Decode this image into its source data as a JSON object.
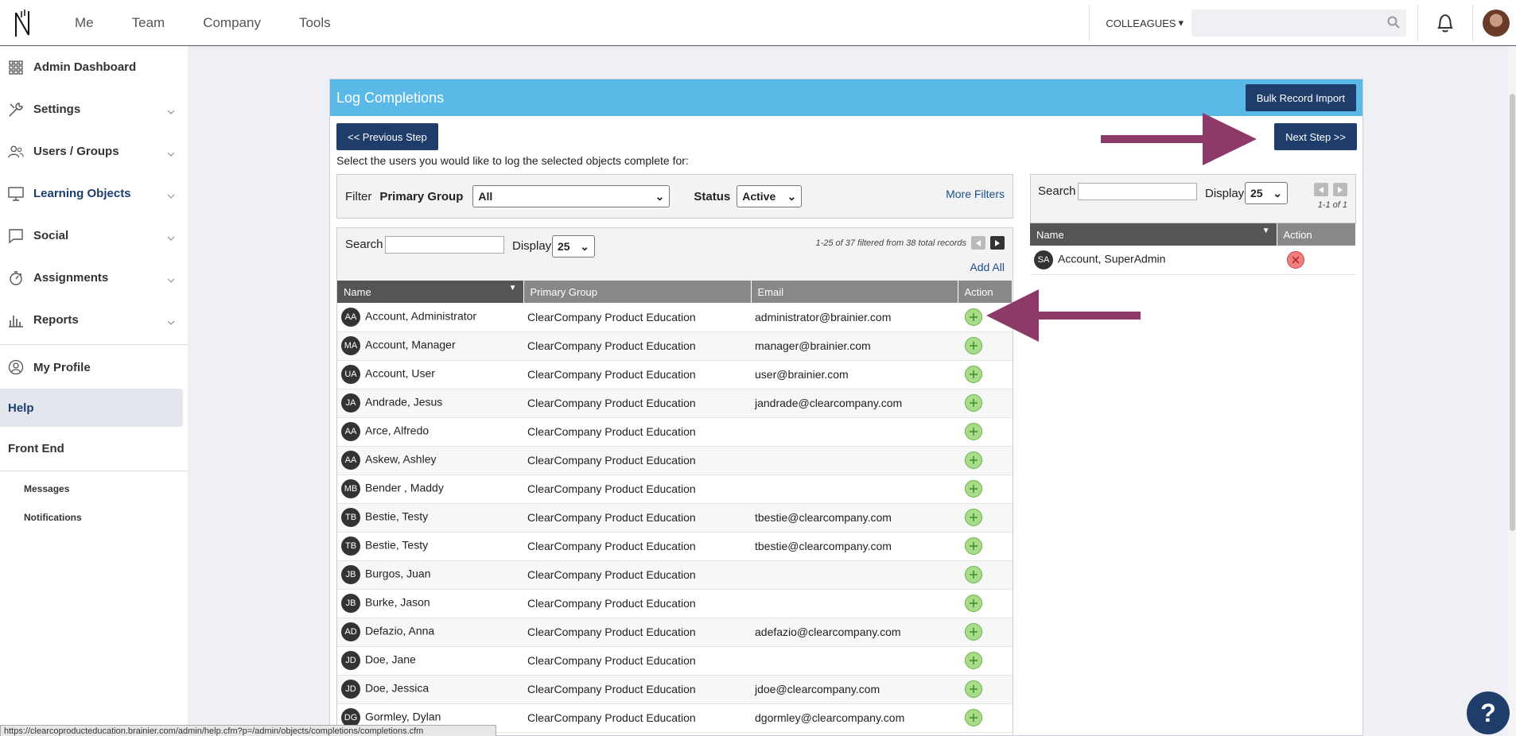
{
  "topnav": {
    "items": [
      "Me",
      "Team",
      "Company",
      "Tools"
    ],
    "colleagues_label": "COLLEAGUES",
    "search_placeholder": ""
  },
  "sidebar": {
    "items": [
      {
        "label": "Admin Dashboard",
        "icon": "grid-icon",
        "expandable": false
      },
      {
        "label": "Settings",
        "icon": "tools-icon",
        "expandable": true
      },
      {
        "label": "Users / Groups",
        "icon": "users-icon",
        "expandable": true
      },
      {
        "label": "Learning Objects",
        "icon": "monitor-icon",
        "expandable": true,
        "active": true
      },
      {
        "label": "Social",
        "icon": "chat-icon",
        "expandable": true
      },
      {
        "label": "Assignments",
        "icon": "stopwatch-icon",
        "expandable": true
      },
      {
        "label": "Reports",
        "icon": "bar-chart-icon",
        "expandable": true
      }
    ],
    "my_profile": "My Profile",
    "help": "Help",
    "front_end": "Front End",
    "messages": "Messages",
    "notifications": "Notifications"
  },
  "panel": {
    "title": "Log Completions",
    "bulk_button": "Bulk Record Import",
    "prev_button": "<< Previous Step",
    "next_button": "Next Step >>",
    "instructions": "Select the users you would like to log the selected objects complete for:"
  },
  "filter": {
    "label": "Filter",
    "group_label": "Primary Group",
    "group_value": "All",
    "status_label": "Status",
    "status_value": "Active",
    "more_filters": "More Filters"
  },
  "available": {
    "search_label": "Search",
    "search_value": "",
    "display_label": "Display",
    "display_value": "25",
    "pager_text": "1-25 of 37 filtered from 38 total records",
    "add_all": "Add All",
    "columns": [
      "Name",
      "Primary Group",
      "Email",
      "Action"
    ],
    "rows": [
      {
        "initials": "AA",
        "name": "Account, Administrator",
        "group": "ClearCompany Product Education",
        "email": "administrator@brainier.com"
      },
      {
        "initials": "MA",
        "name": "Account, Manager",
        "group": "ClearCompany Product Education",
        "email": "manager@brainier.com"
      },
      {
        "initials": "UA",
        "name": "Account, User",
        "group": "ClearCompany Product Education",
        "email": "user@brainier.com"
      },
      {
        "initials": "JA",
        "name": "Andrade, Jesus",
        "group": "ClearCompany Product Education",
        "email": "jandrade@clearcompany.com"
      },
      {
        "initials": "AA",
        "name": "Arce, Alfredo",
        "group": "ClearCompany Product Education",
        "email": ""
      },
      {
        "initials": "AA",
        "name": "Askew, Ashley",
        "group": "ClearCompany Product Education",
        "email": ""
      },
      {
        "initials": "MB",
        "name": "Bender , Maddy",
        "group": "ClearCompany Product Education",
        "email": ""
      },
      {
        "initials": "TB",
        "name": "Bestie, Testy",
        "group": "ClearCompany Product Education",
        "email": "tbestie@clearcompany.com"
      },
      {
        "initials": "TB",
        "name": "Bestie, Testy",
        "group": "ClearCompany Product Education",
        "email": "tbestie@clearcompany.com"
      },
      {
        "initials": "JB",
        "name": "Burgos, Juan",
        "group": "ClearCompany Product Education",
        "email": ""
      },
      {
        "initials": "JB",
        "name": "Burke, Jason",
        "group": "ClearCompany Product Education",
        "email": ""
      },
      {
        "initials": "AD",
        "name": "Defazio, Anna",
        "group": "ClearCompany Product Education",
        "email": "adefazio@clearcompany.com"
      },
      {
        "initials": "JD",
        "name": "Doe, Jane",
        "group": "ClearCompany Product Education",
        "email": ""
      },
      {
        "initials": "JD",
        "name": "Doe, Jessica",
        "group": "ClearCompany Product Education",
        "email": "jdoe@clearcompany.com"
      },
      {
        "initials": "DG",
        "name": "Gormley, Dylan",
        "group": "ClearCompany Product Education",
        "email": "dgormley@clearcompany.com"
      }
    ]
  },
  "selected": {
    "search_label": "Search",
    "search_value": "",
    "display_label": "Display",
    "display_value": "25",
    "pager_text": "1-1 of 1",
    "columns": [
      "Name",
      "Action"
    ],
    "rows": [
      {
        "initials": "SA",
        "name": "Account, SuperAdmin"
      }
    ]
  },
  "status_url": "https://clearcoproducteducation.brainier.com/admin/help.cfm?p=/admin/objects/completions/completions.cfm",
  "help_fab": "?",
  "colors": {
    "header_blue": "#5bb9e8",
    "button_navy": "#1f3d6b",
    "arrow_purple": "#8e3a68",
    "add_green": "#a8dc8a",
    "remove_red": "#f08080"
  }
}
